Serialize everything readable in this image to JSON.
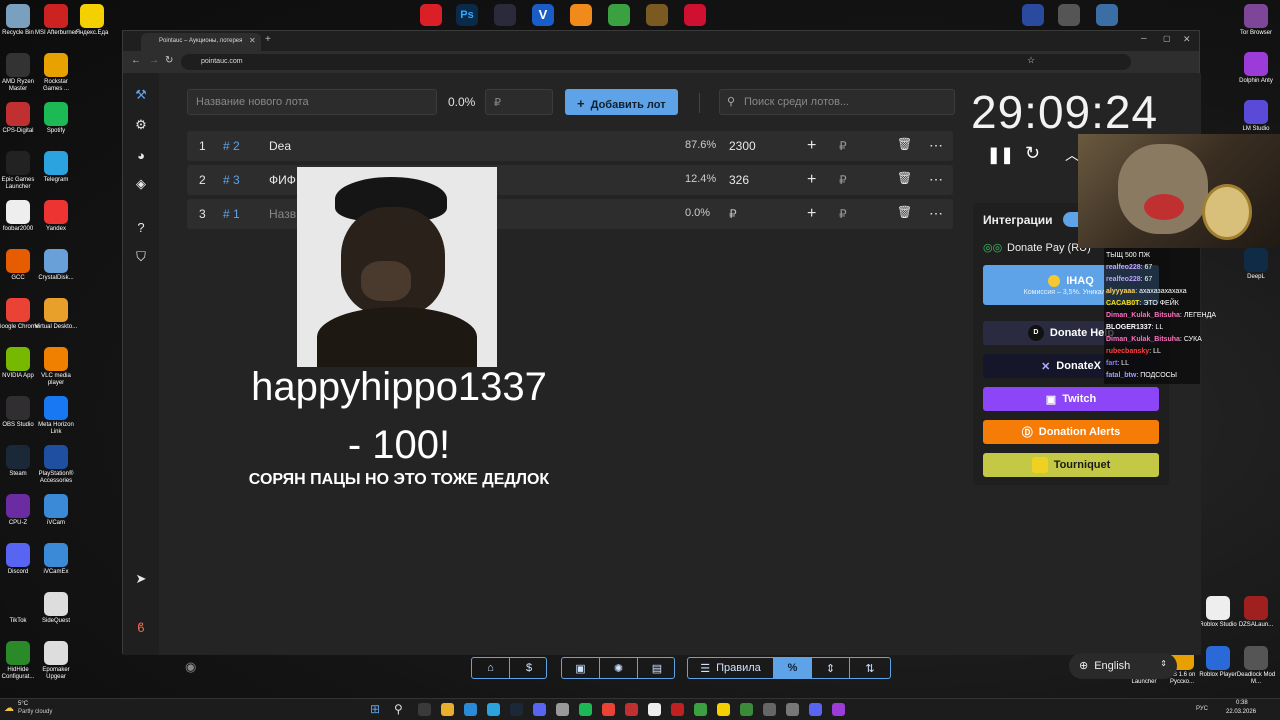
{
  "desktop": {
    "left_icons": [
      {
        "label": "Recycle Bin",
        "name": "recycle-bin-icon",
        "color": "#7aa0c0"
      },
      {
        "label": "MSI Afterburner",
        "name": "msi-afterburner-icon",
        "color": "#c22"
      },
      {
        "label": "Яндекс.Еда",
        "name": "yandex-eda-icon",
        "color": "#f5d000"
      },
      {
        "label": "AMD Ryzen Master",
        "name": "amd-ryzen-master-icon",
        "color": "#333"
      },
      {
        "label": "Rockstar Games ...",
        "name": "rockstar-games-icon",
        "color": "#e8a200"
      },
      {
        "label": "CPS-Digital",
        "name": "cps-digital-icon",
        "color": "#c03030"
      },
      {
        "label": "Spotify",
        "name": "spotify-icon",
        "color": "#1db954"
      },
      {
        "label": "Epic Games Launcher",
        "name": "epic-games-icon",
        "color": "#222"
      },
      {
        "label": "Telegram",
        "name": "telegram-icon",
        "color": "#2aa3df"
      },
      {
        "label": "foobar2000",
        "name": "foobar2000-icon",
        "color": "#eee"
      },
      {
        "label": "Yandex",
        "name": "yandex-browser-icon",
        "color": "#e33"
      },
      {
        "label": "GCC",
        "name": "gcc-icon",
        "color": "#e65c00"
      },
      {
        "label": "CrystalDisk...",
        "name": "crystaldisk-icon",
        "color": "#6aa0d8"
      },
      {
        "label": "Google Chrome",
        "name": "chrome-icon",
        "color": "#ea4335"
      },
      {
        "label": "Virtual Deskto...",
        "name": "virtual-desktop-icon",
        "color": "#e8a02a"
      },
      {
        "label": "NVIDIA App",
        "name": "nvidia-icon",
        "color": "#76b900"
      },
      {
        "label": "VLC media player",
        "name": "vlc-icon",
        "color": "#f08000"
      },
      {
        "label": "OBS Studio",
        "name": "obs-icon",
        "color": "#302e31"
      },
      {
        "label": "Meta Horizon Link",
        "name": "meta-horizon-icon",
        "color": "#1877f2"
      },
      {
        "label": "Steam",
        "name": "steam-icon",
        "color": "#1b2838"
      },
      {
        "label": "PlayStation® Accessories",
        "name": "playstation-icon",
        "color": "#1f4fa0"
      },
      {
        "label": "CPU-Z",
        "name": "cpu-z-icon",
        "color": "#6a2ca0"
      },
      {
        "label": "iVCam",
        "name": "ivcam-icon",
        "color": "#3a8ad8"
      },
      {
        "label": "Discord",
        "name": "discord-icon",
        "color": "#5865f2"
      },
      {
        "label": "iVCamEx",
        "name": "ivcamex-icon",
        "color": "#3a8ad8"
      },
      {
        "label": "TikTok",
        "name": "tiktok-icon",
        "color": "#111"
      },
      {
        "label": "SideQuest",
        "name": "sidequest-icon",
        "color": "#ddd"
      },
      {
        "label": "HidHide Configurat...",
        "name": "hidhide-icon",
        "color": "#2a8a2a"
      },
      {
        "label": "Epomaker Upgear",
        "name": "epomaker-icon",
        "color": "#ddd"
      }
    ],
    "right_icons": [
      {
        "label": "Tor Browser",
        "name": "tor-browser-icon",
        "color": "#7d4698"
      },
      {
        "label": "Dolphin Anty",
        "name": "dolphin-anty-icon",
        "color": "#9b3cd8"
      },
      {
        "label": "LM Studio",
        "name": "lm-studio-icon",
        "color": "#5a4ad8"
      },
      {
        "label": "DeepL",
        "name": "deepl-icon",
        "color": "#0f2b46"
      },
      {
        "label": "Roblox Studio",
        "name": "roblox-studio-icon",
        "color": "#eee"
      },
      {
        "label": "DZSALaun...",
        "name": "dzsa-launcher-icon",
        "color": "#a02020"
      },
      {
        "label": "Majestic Launcher",
        "name": "majestic-launcher-icon",
        "color": "#b02020"
      },
      {
        "label": "CS 1.6 on Русско...",
        "name": "cs16-icon",
        "color": "#e8a000"
      },
      {
        "label": "Roblox Player",
        "name": "roblox-player-icon",
        "color": "#2a6ad8"
      },
      {
        "label": "Deadlock Mod M...",
        "name": "deadlock-mod-icon",
        "color": "#555"
      }
    ]
  },
  "browser": {
    "tab_title": "Pointauc – Аукционы, лотерея",
    "url": "pointauc.com"
  },
  "app": {
    "new_lot_placeholder": "Название нового лота",
    "new_lot_percent": "0.0%",
    "currency_symbol": "₽",
    "add_lot_label": "Добавить лот",
    "search_placeholder": "Поиск среди лотов...",
    "lots": [
      {
        "index": "1",
        "id": "# 2",
        "name": "Dea",
        "percent": "87.6%",
        "amount": "2300",
        "name_placeholder": false
      },
      {
        "index": "2",
        "id": "# 3",
        "name": "ФИФ",
        "percent": "12.4%",
        "amount": "326",
        "name_placeholder": false
      },
      {
        "index": "3",
        "id": "# 1",
        "name": "Назв",
        "percent": "0.0%",
        "amount": "₽",
        "name_placeholder": true
      }
    ],
    "timer": "29:09:24",
    "integrations_title": "Интеграции",
    "donate_pay_label": "Donate Pay (RU)",
    "ihaq_label": "IHAQ",
    "ihaq_sub": "Комиссия – 3,5%. Уникальны",
    "donate_hello_label": "Donate Help",
    "donatex_label": "DonateX",
    "twitch_label": "Twitch",
    "donation_alerts_label": "Donation Alerts",
    "tourniquet_label": "Tourniquet",
    "rules_label": "Правила",
    "language": "English",
    "donor_name": "happyhippo1337",
    "donor_amount": "- 100!",
    "donor_message": "СОРЯН ПАЦЫ НО ЭТО ТОЖЕ ДЕДЛОК"
  },
  "stream_overlay": {
    "chat": [
      {
        "user": "",
        "text": "ТЫЩ 500 ПЖ",
        "color": "#ffffff"
      },
      {
        "user": "realfeo228",
        "text": "67",
        "color": "#c0a0ff"
      },
      {
        "user": "realfeo228",
        "text": "67",
        "color": "#c0a0ff"
      },
      {
        "user": "alyyyaaa",
        "text": "ахахазахахаха",
        "color": "#ffd060"
      },
      {
        "user": "CACAB0T",
        "text": "ЭТО ФЕЙК",
        "color": "#ffe000"
      },
      {
        "user": "Diman_Kulak_Bitsuha",
        "text": "ЛЕГЕНДА",
        "color": "#ff70c0"
      },
      {
        "user": "BLOGER1337",
        "text": "LL",
        "color": "#ffffff"
      },
      {
        "user": "Diman_Kulak_Bitsuha",
        "text": "СУКА",
        "color": "#ff70c0"
      },
      {
        "user": "rubecbansky",
        "text": "LL",
        "color": "#ff4040"
      },
      {
        "user": "fart",
        "text": "LL",
        "color": "#8080ff"
      },
      {
        "user": "fatal_btw",
        "text": "ПОДСОСЫ",
        "color": "#a0a0ff"
      }
    ]
  },
  "taskbar": {
    "weather_temp": "5°C",
    "weather_text": "Partly cloudy",
    "lang": "РУС",
    "time": "0:38",
    "date": "22.03.2026"
  },
  "colors": {
    "accent_blue": "#5ea2e8",
    "twitch": "#8c45f7",
    "donation_alerts": "#f57d07",
    "tourniquet": "#c3c845"
  }
}
